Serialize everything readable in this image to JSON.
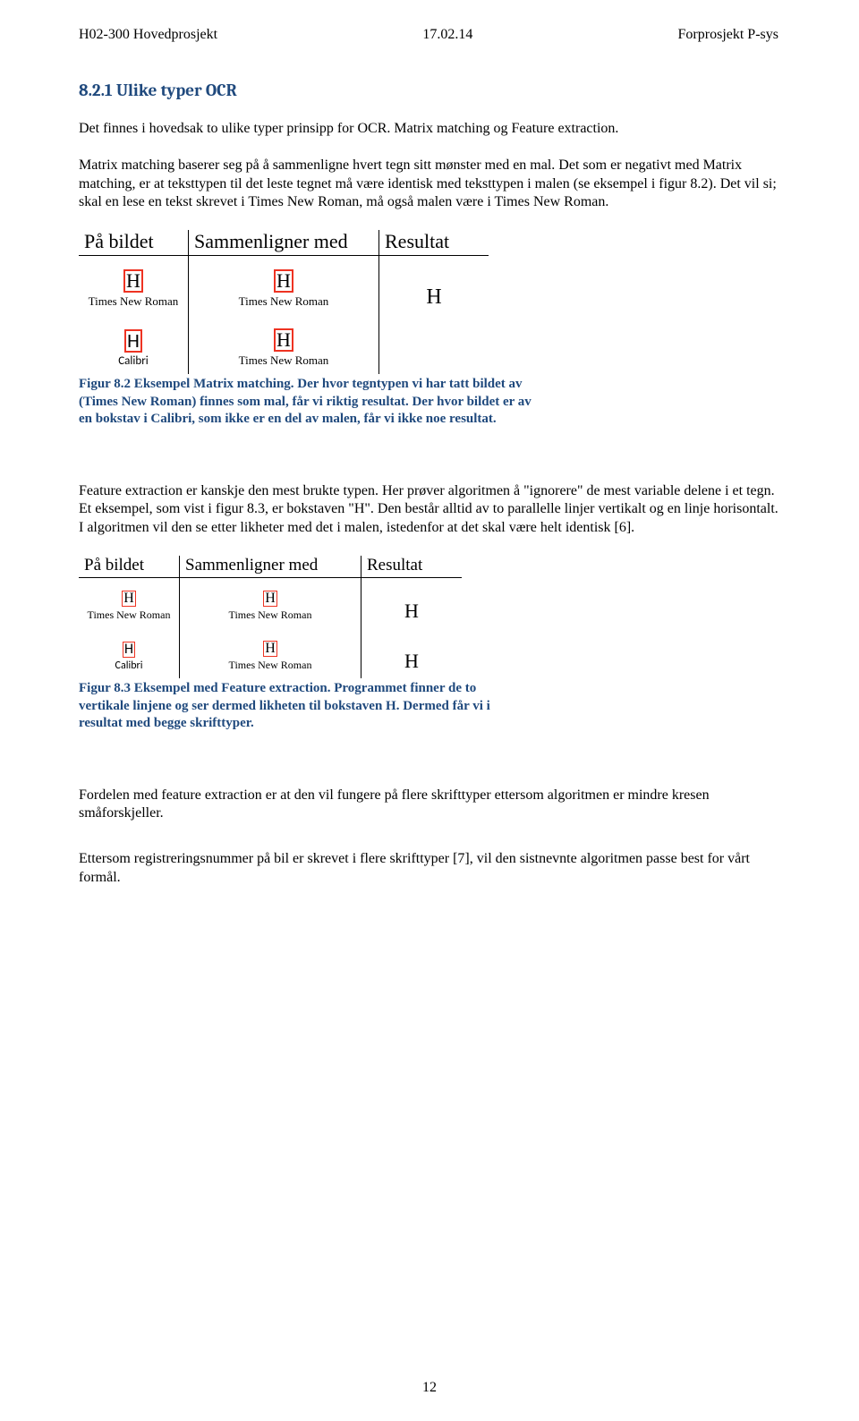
{
  "header": {
    "left": "H02-300 Hovedprosjekt",
    "center": "17.02.14",
    "right": "Forprosjekt P-sys"
  },
  "section": {
    "heading": "8.2.1 Ulike typer OCR",
    "p1": "Det finnes i hovedsak to ulike typer prinsipp for OCR. Matrix matching og Feature extraction.",
    "p2": "Matrix matching baserer seg på å sammenligne hvert tegn sitt mønster med en mal. Det som er negativt med Matrix matching, er at teksttypen til det leste tegnet må være identisk med teksttypen i malen (se eksempel i figur 8.2). Det vil si; skal en lese en tekst skrevet i Times New Roman, må også malen være i Times New Roman."
  },
  "figure1": {
    "table_headers": [
      "På bildet",
      "Sammenligner med",
      "Resultat"
    ],
    "row1": {
      "c1_glyph": "H",
      "c1_label": "Times New Roman",
      "c2_glyph": "H",
      "c2_label": "Times New Roman",
      "c3": "H"
    },
    "row2": {
      "c1_glyph": "H",
      "c1_label": "Calibri",
      "c2_glyph": "H",
      "c2_label": "Times New Roman",
      "c3": ""
    },
    "caption": "Figur 8.2 Eksempel Matrix matching. Der hvor tegntypen vi har tatt bildet av (Times New Roman) finnes som mal, får vi riktig resultat. Der hvor bildet er av en bokstav i Calibri, som ikke er en del av malen, får vi ikke noe resultat."
  },
  "section2": {
    "p1": "Feature extraction er kanskje den mest brukte typen. Her prøver algoritmen å \"ignorere\" de mest variable delene i et tegn. Et eksempel, som vist i figur 8.3, er bokstaven \"H\". Den består alltid av to parallelle linjer vertikalt og en linje horisontalt. I algoritmen vil den se etter likheter med det i malen, istedenfor at det skal være helt identisk [6]."
  },
  "figure2": {
    "table_headers": [
      "På bildet",
      "Sammenligner med",
      "Resultat"
    ],
    "row1": {
      "c1_glyph": "H",
      "c1_label": "Times New Roman",
      "c2_glyph": "H",
      "c2_label": "Times New Roman",
      "c3": "H"
    },
    "row2": {
      "c1_glyph": "H",
      "c1_label": "Calibri",
      "c2_glyph": "H",
      "c2_label": "Times New Roman",
      "c3": "H"
    },
    "caption": "Figur 8.3 Eksempel med Feature extraction. Programmet finner de to vertikale linjene og ser dermed likheten til bokstaven H. Dermed får vi i resultat med begge skrifttyper."
  },
  "section3": {
    "p1": "Fordelen med feature extraction er at den vil fungere på flere skrifttyper ettersom algoritmen er mindre kresen småforskjeller.",
    "p2": "Ettersom registreringsnummer på bil er skrevet i flere skrifttyper [7], vil den sistnevnte algoritmen passe best for vårt formål."
  },
  "page_number": "12"
}
